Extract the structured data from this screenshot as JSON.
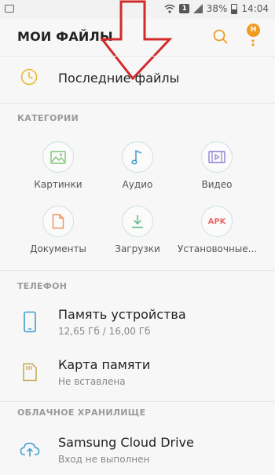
{
  "status_bar": {
    "sim_badge": "1",
    "battery": "38%",
    "time": "14:04",
    "icons": [
      "image-icon",
      "wifi-icon",
      "sim-icon",
      "signal-icon",
      "battery-icon"
    ]
  },
  "app_bar": {
    "title": "МОИ ФАЙЛЫ",
    "notification_badge": "Н",
    "accent_color": "#f09a22"
  },
  "recent": {
    "label": "Последние файлы",
    "icon": "clock-icon"
  },
  "categories": {
    "header": "КАТЕГОРИИ",
    "items": [
      {
        "label": "Картинки",
        "icon": "image-icon",
        "color": "#7cc576"
      },
      {
        "label": "Аудио",
        "icon": "music-note-icon",
        "color": "#3d9ec9"
      },
      {
        "label": "Видео",
        "icon": "video-icon",
        "color": "#8a7fd4"
      },
      {
        "label": "Документы",
        "icon": "document-icon",
        "color": "#f0925a"
      },
      {
        "label": "Загрузки",
        "icon": "download-icon",
        "color": "#5bb88a"
      },
      {
        "label": "Установочные...",
        "icon": "apk-icon",
        "apk_text": "APK",
        "color": "#e86a6a"
      }
    ]
  },
  "phone": {
    "header": "ТЕЛЕФОН",
    "device": {
      "title": "Память устройства",
      "subtitle": "12,65 Гб / 16,00 Гб",
      "icon": "phone-icon"
    },
    "sdcard": {
      "title": "Карта памяти",
      "subtitle": "Не вставлена",
      "icon": "sd-card-icon"
    }
  },
  "cloud": {
    "header": "ОБЛАЧНОЕ ХРАНИЛИЩЕ",
    "samsung": {
      "title": "Samsung Cloud Drive",
      "subtitle": "Вход не выполнен",
      "icon": "cloud-upload-icon"
    }
  }
}
